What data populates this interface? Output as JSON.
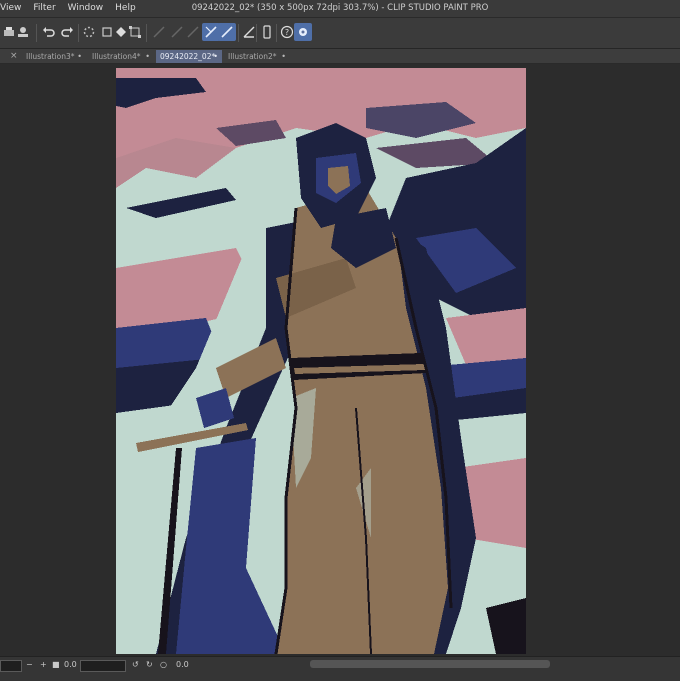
{
  "menu": {
    "items": [
      "View",
      "Filter",
      "Window",
      "Help"
    ]
  },
  "window": {
    "title": "09242022_02* (350 x 500px 72dpi 303.7%)  - CLIP STUDIO PAINT PRO"
  },
  "toolbar": {
    "icons": [
      "printer-icon",
      "stamp-icon",
      "undo-icon",
      "redo-icon",
      "loading-icon",
      "fill-icon",
      "transform-icon",
      "snap-off-icon",
      "snap-ruler-icon",
      "snap-special-ruler-icon",
      "ruler-icon",
      "tablet-icon",
      "help-icon",
      "settings-icon"
    ]
  },
  "tabs": [
    {
      "label": "Illustration3*",
      "active": false
    },
    {
      "label": "Illustration4*",
      "active": false
    },
    {
      "label": "09242022_02*",
      "active": true
    },
    {
      "label": "Illustration2*",
      "active": false
    }
  ],
  "tab_close_glyph": "×",
  "statusbar": {
    "zoom_value": "0.0",
    "rotation_value": "0.0"
  },
  "colors": {
    "sky_pink": "#c38b95",
    "sky_light": "#c0d8cf",
    "cloud_navy": "#1d2240",
    "cloud_blue": "#2f3a78",
    "figure_brown": "#8c7257",
    "outline_dark": "#17131c",
    "accent_tab": "#5b6785"
  }
}
